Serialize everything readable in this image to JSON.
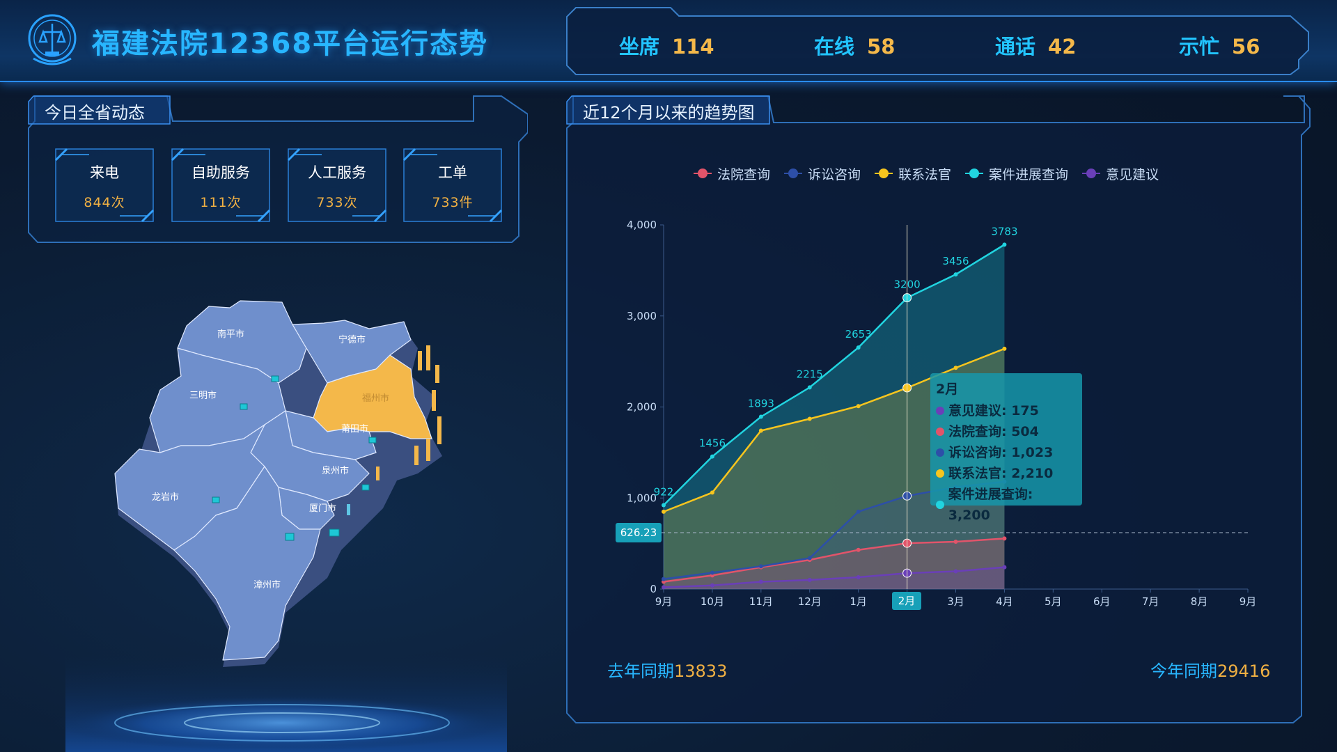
{
  "header": {
    "title": "福建法院12368平台运行态势",
    "stats": [
      {
        "label": "坐席",
        "value": "114"
      },
      {
        "label": "在线",
        "value": "58"
      },
      {
        "label": "通话",
        "value": "42"
      },
      {
        "label": "示忙",
        "value": "56"
      }
    ]
  },
  "today_panel": {
    "title": "今日全省动态",
    "cards": [
      {
        "label": "来电",
        "value": "844次"
      },
      {
        "label": "自助服务",
        "value": "111次"
      },
      {
        "label": "人工服务",
        "value": "733次"
      },
      {
        "label": "工单",
        "value": "733件"
      }
    ]
  },
  "map": {
    "regions": [
      {
        "name": "南平市",
        "highlighted": false
      },
      {
        "name": "宁德市",
        "highlighted": false
      },
      {
        "name": "三明市",
        "highlighted": false
      },
      {
        "name": "福州市",
        "highlighted": true
      },
      {
        "name": "莆田市",
        "highlighted": false
      },
      {
        "name": "泉州市",
        "highlighted": false
      },
      {
        "name": "龙岩市",
        "highlighted": false
      },
      {
        "name": "厦门市",
        "highlighted": false
      },
      {
        "name": "漳州市",
        "highlighted": false
      }
    ],
    "colors": {
      "base": "#6f8fcc",
      "highlight": "#f4b84a"
    }
  },
  "trend_panel": {
    "title": "近12个月以来的趋势图",
    "pointer_y_label": "626.23",
    "pointer_x_label": "2月",
    "tooltip": {
      "title": "2月",
      "rows": [
        {
          "label": "意见建议: 175",
          "color": "#6a3fb8"
        },
        {
          "label": "法院查询: 504",
          "color": "#e2546a"
        },
        {
          "label": "诉讼咨询: 1,023",
          "color": "#2d4fa8"
        },
        {
          "label": "联系法官: 2,210",
          "color": "#f7c51e"
        },
        {
          "label": "案件进展查询: 3,200",
          "color": "#21d4e0"
        }
      ]
    },
    "footer_left": {
      "label": "去年同期",
      "value": "13833"
    },
    "footer_right": {
      "label": "今年同期",
      "value": "29416"
    }
  },
  "chart_data": {
    "type": "area",
    "categories": [
      "9月",
      "10月",
      "11月",
      "12月",
      "1月",
      "2月",
      "3月",
      "4月",
      "5月",
      "6月",
      "7月",
      "8月",
      "9月"
    ],
    "ylim": [
      0,
      4000
    ],
    "yticks": [
      "0",
      "1,000",
      "2,000",
      "3,000",
      "4,000"
    ],
    "legend_position": "top",
    "series": [
      {
        "name": "法院查询",
        "color": "#e2546a",
        "values": [
          80,
          150,
          240,
          320,
          430,
          504,
          520,
          555
        ]
      },
      {
        "name": "诉讼咨询",
        "color": "#2d4fa8",
        "values": [
          110,
          180,
          250,
          340,
          850,
          1023,
          1120,
          1180
        ]
      },
      {
        "name": "联系法官",
        "color": "#f7c51e",
        "values": [
          850,
          1060,
          1740,
          1870,
          2010,
          2210,
          2430,
          2640
        ]
      },
      {
        "name": "案件进展查询",
        "color": "#21d4e0",
        "values": [
          922,
          1456,
          1893,
          2215,
          2653,
          3200,
          3456,
          3783
        ],
        "labels": [
          "922",
          "1456",
          "1893",
          "2215",
          "2653",
          "3200",
          "3456",
          "3783"
        ]
      },
      {
        "name": "意见建议",
        "color": "#6a3fb8",
        "values": [
          20,
          40,
          80,
          100,
          130,
          175,
          195,
          240
        ]
      }
    ]
  }
}
